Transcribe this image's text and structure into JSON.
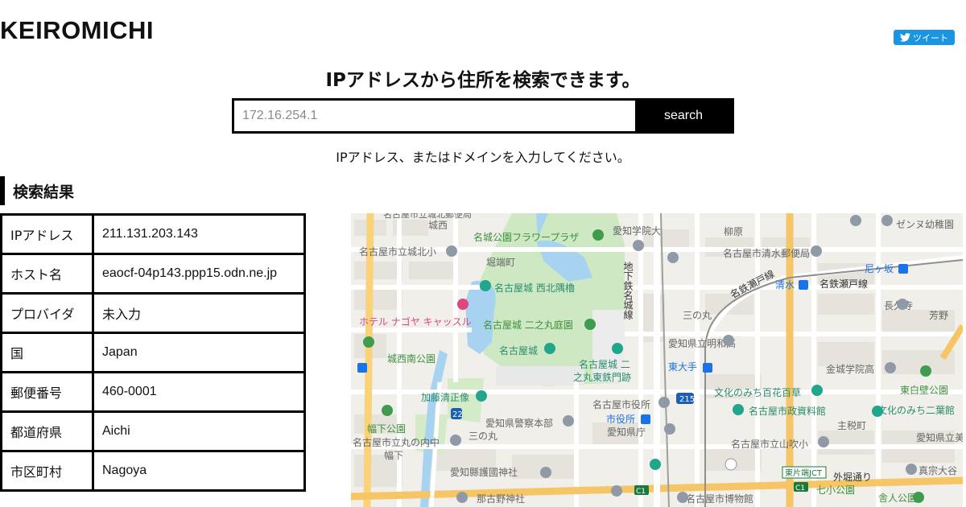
{
  "header": {
    "brand": "KEIROMICHI",
    "tweet_label": "ツイート"
  },
  "search": {
    "headline": "IPアドレスから住所を検索できます。",
    "placeholder": "172.16.254.1",
    "button_label": "search",
    "hint": "IPアドレス、またはドメインを入力してください。"
  },
  "results": {
    "title": "検索結果",
    "rows": [
      {
        "label": "IPアドレス",
        "value": "211.131.203.143"
      },
      {
        "label": "ホスト名",
        "value": "eaocf-04p143.ppp15.odn.ne.jp"
      },
      {
        "label": "プロバイダ",
        "value": "未入力"
      },
      {
        "label": "国",
        "value": "Japan"
      },
      {
        "label": "郵便番号",
        "value": "460-0001"
      },
      {
        "label": "都道府県",
        "value": "Aichi"
      },
      {
        "label": "市区町村",
        "value": "Nagoya"
      }
    ]
  },
  "map": {
    "labels": {
      "castle_north": "名古屋市立城北小",
      "castle_jo": "城西",
      "flower": "名城公園フラワープラザ",
      "aichi_gakuin": "愛知学院大",
      "yanagihara": "柳原",
      "zenzenu": "ゼンヌ幼稚園",
      "horibata": "堀端町",
      "shimizu_post": "名古屋市清水郵便局",
      "nigagasaka": "尼ヶ坂",
      "chikatetsu": "地下鉄名城線",
      "castle_nw": "名古屋城 西北隅櫓",
      "meitetsu_seto": "名鉄瀬戸線",
      "shimizu": "清水",
      "meitetsu_seto2": "名鉄瀬戸線",
      "hotel": "ホテル ナゴヤ キャッスル",
      "ninomaru_garden": "名古屋城 二之丸庭園",
      "sannomaru": "三の丸",
      "chokyu": "長久寺",
      "yoshino": "芳野",
      "meijo": "名古屋城",
      "kenritsu": "愛知県立明和高",
      "josei_park": "城西南公園",
      "ninomaru_east": "名古屋城 二",
      "ninomaru_east2": "之丸東鉄門跡",
      "higashi_ote": "東大手",
      "kinjo": "金城学院高",
      "kato": "加藤清正像",
      "shiyakusho": "名古屋市役所",
      "bunka_road": "文化のみち百花百草",
      "higashi_shiraka": "東白壁公園",
      "police": "愛知県警察本部",
      "shiyakusho_st": "市役所",
      "seiji": "名古屋市政資料館",
      "bunka_futaba": "文化のみち二葉館",
      "hori_park": "幅下公園",
      "kencho": "愛知県庁",
      "shumoku": "主税町",
      "marunouchi": "名古屋市立丸の内中",
      "sannomaru2": "三の丸",
      "yamabuki": "名古屋市立山吹小",
      "aichi_kenritsu": "愛知県立美",
      "haba": "幅下",
      "gokoku": "愛知縣護國神社",
      "higashi_kata": "東片端JCT",
      "soto": "外堀通り",
      "shinsou": "真宗大谷",
      "nanohana": "那古野神社",
      "shimizu_park": "七小公園",
      "museum": "名古屋市博物館",
      "kajin_park": "舎人公園",
      "route22": "22",
      "route215": "215",
      "c1a": "C1",
      "c1b": "C1"
    }
  }
}
